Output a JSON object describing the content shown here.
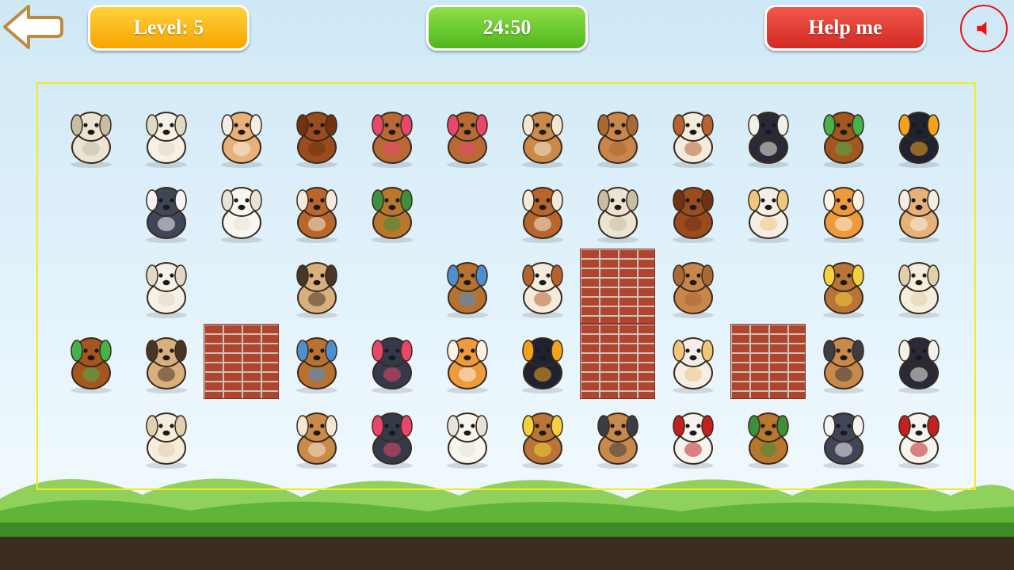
{
  "hud": {
    "level_label": "Level: 5",
    "timer": "24:50",
    "help_label": "Help me",
    "back_icon": "back-arrow-icon",
    "sound_icon": "speaker-icon"
  },
  "colors": {
    "level_pill": "#f9b81a",
    "timer_pill": "#6cc92f",
    "help_pill": "#e23b33",
    "board_border": "#f4ec1a",
    "sound_ring": "#e81313"
  },
  "board": {
    "columns": 12,
    "rows": 5,
    "tiles": [
      [
        "komondor-dog",
        "maltese-dog",
        "chihuahua-bone-dog",
        "brown-poodle-dog",
        "cavalier-pink-bow-dog",
        "cavalier-pink-bow-dog",
        "bulldog-dog",
        "shar-pei-dog",
        "grinning-bulldog-dog",
        "boston-terrier-tophat-dog",
        "dachshund-hula-dog",
        "scottie-ball-dog"
      ],
      [
        null,
        "husky-hat-dog",
        "white-fluffy-dog",
        "saint-bernard-dog",
        "flying-hound-dog",
        null,
        "saint-bernard-dog",
        "komondor-dog",
        "brown-poodle-dog",
        "chihuahua-martini-dog",
        "corgi-pair-dog",
        "chihuahua-bone-dog"
      ],
      [
        null,
        "maltese-dog",
        null,
        "pug-dog",
        null,
        "dancing-dog",
        "grinning-bulldog-dog",
        "brick",
        "shar-pei-dog",
        null,
        "basset-party-dog",
        "lab-puppy-dog"
      ],
      [
        "dachshund-hula-dog",
        "pug-dog",
        "brick",
        "dancing-dog",
        "black-poodle-dog",
        "corgi-pair-dog",
        "scottie-ball-dog",
        "brick",
        "chihuahua-martini-dog",
        "brick",
        "weightlifter-dog",
        "boston-terrier-tophat-dog"
      ],
      [
        null,
        "lab-puppy-dog",
        null,
        "bulldog-dog",
        "black-poodle-dog",
        "white-fluffy-dog",
        "basset-party-dog",
        "weightlifter-dog",
        "dalmatian-king-dog",
        "flying-hound-dog",
        "husky-hat-dog",
        "dalmatian-king-dog"
      ]
    ]
  },
  "dog_colors": {
    "komondor-dog": [
      "#ece4d2",
      "#c9bda4"
    ],
    "maltese-dog": [
      "#f6f1e6",
      "#e2d8c6"
    ],
    "chihuahua-bone-dog": [
      "#e6b27a",
      "#f4efe4"
    ],
    "brown-poodle-dog": [
      "#9b4c1f",
      "#6f3312"
    ],
    "cavalier-pink-bow-dog": [
      "#b96a34",
      "#e8466a"
    ],
    "bulldog-dog": [
      "#c98a4a",
      "#f3e6d2"
    ],
    "shar-pei-dog": [
      "#c9854a",
      "#a86a34"
    ],
    "grinning-bulldog-dog": [
      "#f4ebdd",
      "#b4622e"
    ],
    "boston-terrier-tophat-dog": [
      "#2a2a36",
      "#f2f0ea"
    ],
    "dachshund-hula-dog": [
      "#a4561f",
      "#45b34a"
    ],
    "scottie-ball-dog": [
      "#1f2230",
      "#f3a21b"
    ],
    "husky-hat-dog": [
      "#3f4658",
      "#f4f4f4"
    ],
    "white-fluffy-dog": [
      "#f8f6f0",
      "#e8e3d8"
    ],
    "saint-bernard-dog": [
      "#b8662c",
      "#f4eadb"
    ],
    "flying-hound-dog": [
      "#b9772e",
      "#3d8f3a"
    ],
    "chihuahua-martini-dog": [
      "#f4eee6",
      "#f0c77a"
    ],
    "corgi-pair-dog": [
      "#ef9a3c",
      "#fbf2e4"
    ],
    "pug-dog": [
      "#d8b07e",
      "#4a3426"
    ],
    "dancing-dog": [
      "#b8722f",
      "#4d8fcf"
    ],
    "basset-party-dog": [
      "#b97438",
      "#f2d13c"
    ],
    "lab-puppy-dog": [
      "#f6eedd",
      "#e2cfae"
    ],
    "black-poodle-dog": [
      "#353a4a",
      "#e8466a"
    ],
    "weightlifter-dog": [
      "#c88a4a",
      "#3c3c44"
    ],
    "dalmatian-king-dog": [
      "#f6f4ef",
      "#c32020"
    ]
  }
}
